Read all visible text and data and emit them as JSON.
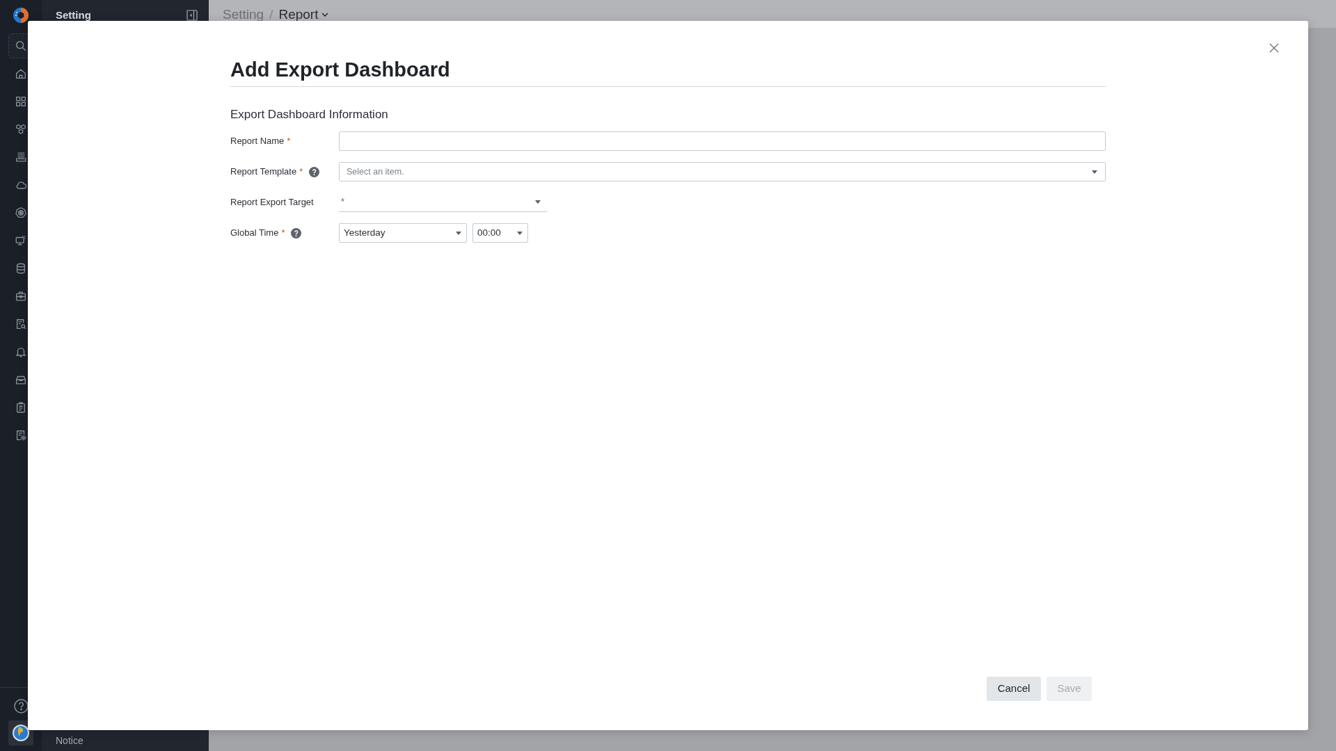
{
  "sidebar": {
    "title": "Setting",
    "footer_item": "Notice"
  },
  "breadcrumb": {
    "separator": "/",
    "items": [
      {
        "label": "Setting",
        "current": false
      },
      {
        "label": "Report",
        "current": true
      }
    ]
  },
  "dialog": {
    "title": "Add Export Dashboard",
    "section_title": "Export Dashboard Information",
    "fields": [
      {
        "kind": "text",
        "label": "Report Name",
        "required_mark": "*",
        "help": false
      },
      {
        "kind": "select",
        "label": "Report Template",
        "required_mark": "*",
        "help": true,
        "placeholder": "Select an item."
      },
      {
        "kind": "underline-select",
        "label": "Report Export Target",
        "help": false,
        "value": "*"
      },
      {
        "kind": "select-group",
        "label": "Global Time",
        "required_mark": "*",
        "help": true,
        "selects": [
          {
            "value": "Yesterday"
          },
          {
            "value": "00:00"
          }
        ]
      }
    ],
    "buttons": [
      {
        "label": "Cancel",
        "disabled": false
      },
      {
        "label": "Save",
        "disabled": true
      }
    ]
  }
}
